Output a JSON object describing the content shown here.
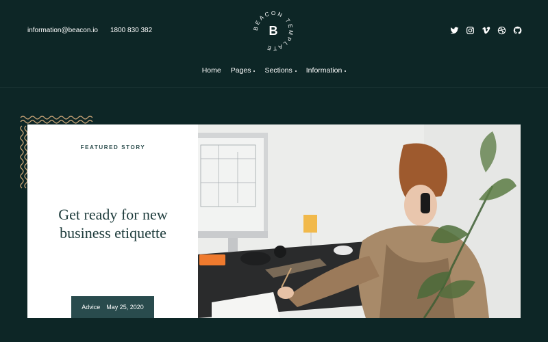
{
  "header": {
    "email": "information@beacon.io",
    "phone": "1800 830 382",
    "logo": {
      "letter": "B",
      "ring_text": "BEACON TEMPLATE"
    },
    "social": [
      "twitter-icon",
      "instagram-icon",
      "vimeo-icon",
      "dribbble-icon",
      "github-icon"
    ]
  },
  "nav": {
    "items": [
      {
        "label": "Home"
      },
      {
        "label": "Pages"
      },
      {
        "label": "Sections"
      },
      {
        "label": "Information"
      }
    ]
  },
  "featured": {
    "eyebrow": "FEATURED STORY",
    "title_line1": "Get ready for new",
    "title_line2": "business etiquette",
    "category": "Advice",
    "date": "May 25, 2020"
  },
  "colors": {
    "background": "#0d2626",
    "accent_bar": "#294b4d",
    "headline": "#1d3b3b",
    "wave_accent": "#c9a477"
  }
}
